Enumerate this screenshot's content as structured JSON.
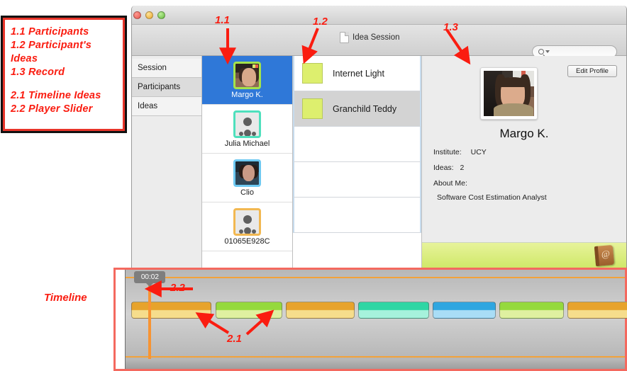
{
  "legend": {
    "lines": [
      "1.1 Participants",
      "1.2 Participant's",
      "Ideas",
      "1.3 Record"
    ],
    "lines2": [
      "2.1 Timeline Ideas",
      "2.2 Player Slider"
    ]
  },
  "annotations": {
    "a11": "1.1",
    "a12": "1.2",
    "a13": "1.3",
    "a21": "2.1",
    "a22": "2.2",
    "timeline_label": "Timeline"
  },
  "window": {
    "traffic_lights": [
      "close-red",
      "minimize-yellow",
      "zoom-green"
    ],
    "toolbar": {
      "doc_icon": "document-icon",
      "title": "Idea Session",
      "search_placeholder": "",
      "search_value": "",
      "search_icon": "search-icon",
      "search_caret": "chevron-down-icon"
    }
  },
  "sidebar": {
    "items": [
      {
        "label": "Session",
        "selected": false
      },
      {
        "label": "Participants",
        "selected": true
      },
      {
        "label": "Ideas",
        "selected": false
      }
    ]
  },
  "participants": {
    "rows": [
      {
        "name": "Margo K.",
        "selected": true,
        "border_color": "#a4e34b",
        "avatar": "photo-margo"
      },
      {
        "name": "Julia Michael",
        "selected": false,
        "border_color": "#4fe0bd",
        "avatar": "person-placeholder-icon"
      },
      {
        "name": "Clio",
        "selected": false,
        "border_color": "#6ec9f2",
        "avatar": "photo-clio"
      },
      {
        "name": "01065E928C",
        "selected": false,
        "border_color": "#f2b851",
        "avatar": "person-placeholder-icon"
      }
    ]
  },
  "ideas": {
    "rows": [
      {
        "label": "Internet Light",
        "selected": false,
        "swatch": "#ddef6e"
      },
      {
        "label": "Granchild Teddy",
        "selected": true,
        "swatch": "#ddef6e"
      },
      {
        "label": "",
        "selected": false,
        "swatch": ""
      },
      {
        "label": "",
        "selected": false,
        "swatch": ""
      },
      {
        "label": "",
        "selected": false,
        "swatch": ""
      }
    ]
  },
  "profile": {
    "edit_button": "Edit Profile",
    "photo": "photo-margo-large",
    "name": "Margo K.",
    "institute_label": "Institute:",
    "institute_value": "UCY",
    "ideas_label": "Ideas:",
    "ideas_value": "2",
    "about_label": "About Me:",
    "about_value": "Software Cost Estimation Analyst",
    "green_bar_color": "#ddef6e",
    "addressbook_icon": "address-book-icon"
  },
  "timeline": {
    "playhead_time": "00:02",
    "playhead_x_pct": 4.6,
    "segments": [
      {
        "color": "#e7a32c",
        "class": "s-orange",
        "left_pct": 1.2,
        "width_pct": 16.0
      },
      {
        "color": "#95d93d",
        "class": "s-green",
        "left_pct": 18.0,
        "width_pct": 13.4
      },
      {
        "color": "#e7a32c",
        "class": "s-orange",
        "left_pct": 32.1,
        "width_pct": 13.8
      },
      {
        "color": "#2fd6a4",
        "class": "s-teal",
        "left_pct": 46.6,
        "width_pct": 14.2
      },
      {
        "color": "#2fa6e0",
        "class": "s-blue",
        "left_pct": 61.5,
        "width_pct": 12.6
      },
      {
        "color": "#95d93d",
        "class": "s-green",
        "left_pct": 74.8,
        "width_pct": 13.0
      },
      {
        "color": "#e7a32c",
        "class": "s-orange",
        "left_pct": 88.5,
        "width_pct": 12.5
      }
    ]
  }
}
